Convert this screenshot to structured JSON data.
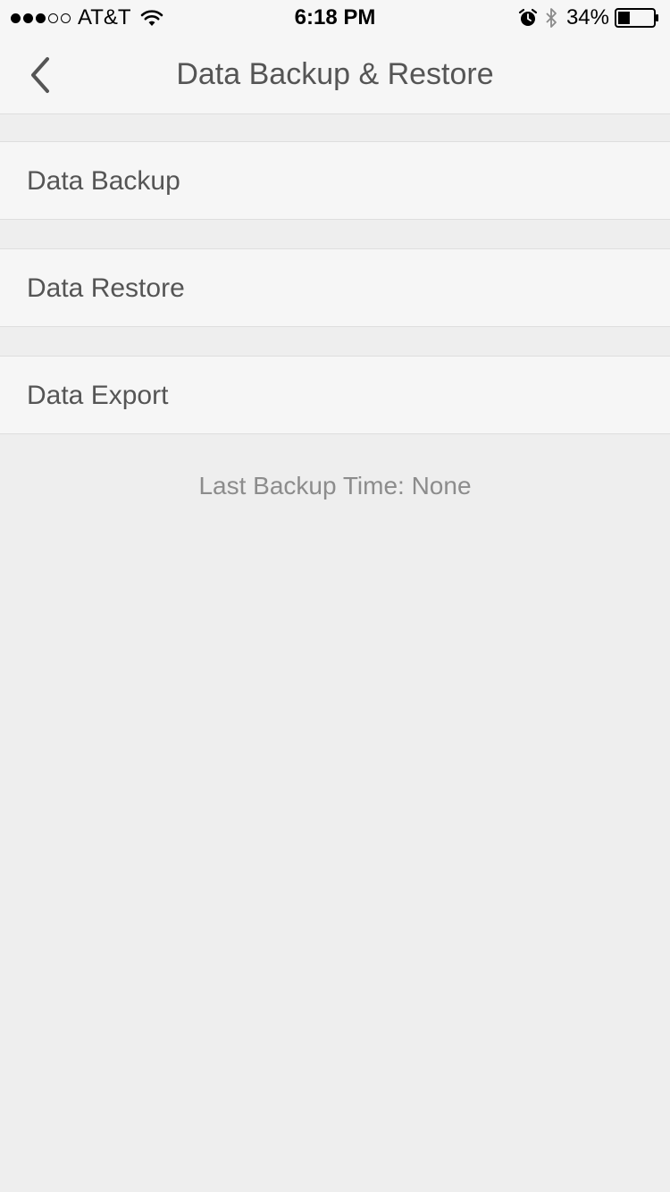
{
  "status_bar": {
    "carrier": "AT&T",
    "time": "6:18 PM",
    "battery_percent": "34%",
    "battery_level": 0.34,
    "signal_bars_filled": 3,
    "signal_bars_total": 5,
    "icons": [
      "wifi-icon",
      "alarm-icon",
      "bluetooth-icon",
      "battery-icon"
    ]
  },
  "nav": {
    "title": "Data Backup & Restore",
    "back_icon": "chevron-left-icon"
  },
  "menu": {
    "items": [
      {
        "label": "Data Backup"
      },
      {
        "label": "Data Restore"
      },
      {
        "label": "Data Export"
      }
    ]
  },
  "footer": {
    "last_backup": "Last Backup Time: None"
  },
  "colors": {
    "background": "#eeeeee",
    "row_background": "#f6f6f6",
    "text": "#555555",
    "muted_text": "#8c8c8c",
    "divider": "#dedede"
  }
}
